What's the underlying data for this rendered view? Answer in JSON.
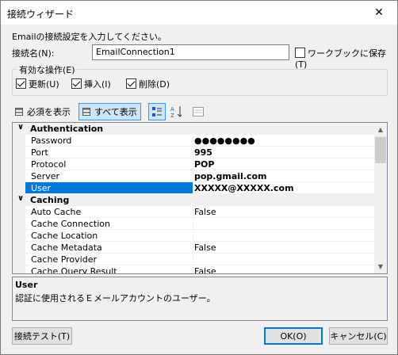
{
  "window": {
    "title": "接続ウィザード",
    "close_glyph": "✕"
  },
  "intro": "Emailの接続設定を入力してください。",
  "connection_name": {
    "label": "接続名(N):",
    "value": "EmailConnection1"
  },
  "save_to_workbook": {
    "label": "ワークブックに保存(T)",
    "checked": false
  },
  "operations": {
    "legend": "有効な操作(E)",
    "items": [
      {
        "label": "更新(U)",
        "checked": true
      },
      {
        "label": "挿入(I)",
        "checked": true
      },
      {
        "label": "削除(D)",
        "checked": true
      }
    ]
  },
  "toolbar": {
    "required_label": "必須を表示",
    "all_label": "すべて表示",
    "sort_icon_text": "A↓Z"
  },
  "grid": {
    "categories": [
      {
        "name": "Authentication",
        "properties": [
          {
            "name": "Password",
            "value": "●●●●●●●●",
            "bold": true
          },
          {
            "name": "Port",
            "value": "995",
            "bold": true
          },
          {
            "name": "Protocol",
            "value": "POP",
            "bold": true
          },
          {
            "name": "Server",
            "value": "pop.gmail.com",
            "bold": true
          },
          {
            "name": "User",
            "value": "XXXXX@XXXXX.com",
            "bold": true,
            "selected": true
          }
        ]
      },
      {
        "name": "Caching",
        "properties": [
          {
            "name": "Auto Cache",
            "value": "False",
            "bold": false
          },
          {
            "name": "Cache Connection",
            "value": "",
            "bold": false
          },
          {
            "name": "Cache Location",
            "value": "",
            "bold": false
          },
          {
            "name": "Cache Metadata",
            "value": "False",
            "bold": false
          },
          {
            "name": "Cache Provider",
            "value": "",
            "bold": false
          },
          {
            "name": "Cache Query Result",
            "value": "False",
            "bold": false
          }
        ]
      }
    ]
  },
  "description": {
    "title": "User",
    "text": "認証に使用されるＥメールアカウントのユーザー。"
  },
  "buttons": {
    "test": "接続テスト(T)",
    "ok": "OK(O)",
    "cancel": "キャンセル(C)"
  }
}
